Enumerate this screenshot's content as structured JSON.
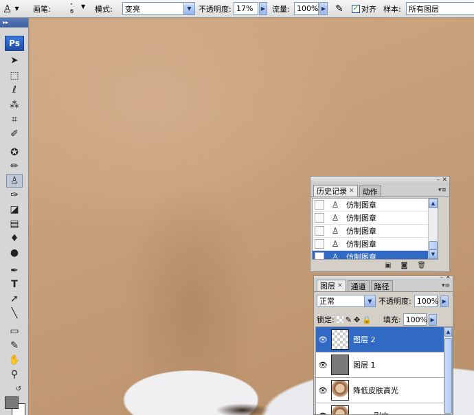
{
  "options_bar": {
    "brush_label": "画笔:",
    "brush_size": "6",
    "mode_label": "模式:",
    "mode_value": "变亮",
    "opacity_label": "不透明度:",
    "opacity_value": "17%",
    "flow_label": "流量:",
    "flow_value": "100%",
    "aligned_label": "对齐",
    "aligned_checked": true,
    "sample_label": "样本:",
    "sample_value": "所有图层"
  },
  "toolbox": {
    "logo": "Ps",
    "tools": [
      "move-tool-icon",
      "marquee-tool-icon",
      "lasso-tool-icon",
      "magic-wand-icon",
      "crop-tool-icon",
      "slice-tool-icon",
      "healing-brush-icon",
      "brush-tool-icon",
      "clone-stamp-icon",
      "history-brush-icon",
      "eraser-icon",
      "gradient-icon",
      "blur-icon",
      "dodge-icon",
      "pen-tool-icon",
      "type-tool-icon",
      "path-select-icon",
      "line-tool-icon",
      "notes-icon",
      "eyedropper-icon",
      "hand-tool-icon",
      "zoom-tool-icon"
    ],
    "active_tool": "clone-stamp-icon",
    "foreground_color": "#7a7a7a",
    "background_color": "#ffffff"
  },
  "history_panel": {
    "tabs": [
      {
        "label": "历史记录",
        "active": true
      },
      {
        "label": "动作",
        "active": false
      }
    ],
    "items": [
      {
        "label": "仿制图章",
        "selected": false
      },
      {
        "label": "仿制图章",
        "selected": false
      },
      {
        "label": "仿制图章",
        "selected": false
      },
      {
        "label": "仿制图章",
        "selected": false
      },
      {
        "label": "仿制图章",
        "selected": true
      }
    ]
  },
  "layers_panel": {
    "tabs": [
      {
        "label": "图层",
        "active": true
      },
      {
        "label": "通道",
        "active": false
      },
      {
        "label": "路径",
        "active": false
      }
    ],
    "blend_mode": "正常",
    "opacity_label": "不透明度:",
    "opacity_value": "100%",
    "lock_label": "锁定:",
    "fill_label": "填充:",
    "fill_value": "100%",
    "layers": [
      {
        "name": "图层 2",
        "selected": true,
        "thumb": "checker"
      },
      {
        "name": "图层 1",
        "selected": false,
        "thumb": "gray"
      },
      {
        "name": "降低皮肤高光",
        "selected": false,
        "thumb": "photo"
      },
      {
        "name": "副本",
        "selected": false,
        "thumb": "photo"
      }
    ]
  },
  "colors": {
    "selection": "#316ac5",
    "panel_bg": "#d4d0c8"
  }
}
